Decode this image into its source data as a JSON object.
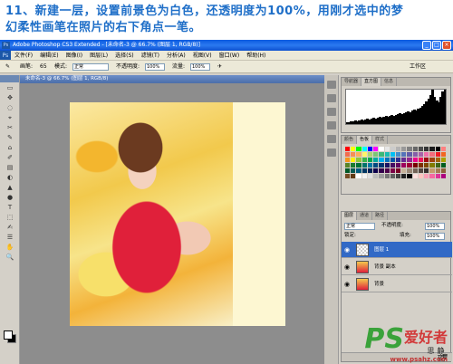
{
  "caption": {
    "line1": "11、新建一层，设置前景色为白色，还透明度为100%，用刚才选中的梦",
    "line2": "幻柔性画笔在照片的右下角点一笔。"
  },
  "window": {
    "title": "Adobe Photoshop CS3 Extended - [未命名-3 @ 66.7% (图层 1, RGB/8)]",
    "app_icon": "Ps",
    "buttons": [
      "_",
      "□",
      "×"
    ]
  },
  "menu": {
    "items": [
      "文件(F)",
      "编辑(E)",
      "图像(I)",
      "图层(L)",
      "选择(S)",
      "滤镜(T)",
      "分析(A)",
      "视图(V)",
      "窗口(W)",
      "帮助(H)"
    ]
  },
  "options": {
    "brush_label": "画笔:",
    "brush_size": "65",
    "mode_label": "模式:",
    "mode_value": "正常",
    "opacity_label": "不透明度:",
    "opacity_value": "100%",
    "flow_label": "流量:",
    "flow_value": "100%",
    "workspace_label": "工作区"
  },
  "document": {
    "tab_title": "未命名-3 @ 66.7% (图层 1, RGB/8)"
  },
  "tools": [
    "▭",
    "✥",
    "◌",
    "⌖",
    "✂",
    "✎",
    "⌂",
    "✐",
    "▤",
    "◐",
    "▲",
    "●",
    "T",
    "⬚",
    "✍",
    "☰",
    "✋",
    "🔍"
  ],
  "panels": {
    "navigator_tabs": [
      "导航器",
      "直方图",
      "信息"
    ],
    "swatch_tabs": [
      "颜色",
      "色板",
      "样式"
    ],
    "layer_tabs": [
      "图层",
      "通道",
      "路径"
    ],
    "blend_mode": "正常",
    "opacity_label": "不透明度:",
    "opacity_value": "100%",
    "lock_label": "锁定:",
    "fill_label": "填充:",
    "fill_value": "100%",
    "layers": [
      {
        "name": "图层 1",
        "selected": true
      },
      {
        "name": "背景 副本",
        "selected": false
      },
      {
        "name": "背景",
        "selected": false
      }
    ]
  },
  "swatch_colors": [
    "#ff0000",
    "#ffff00",
    "#00ff00",
    "#00ffff",
    "#0000ff",
    "#ff00ff",
    "#ffffff",
    "#e6e6e6",
    "#cccccc",
    "#b3b3b3",
    "#999999",
    "#808080",
    "#666666",
    "#4d4d4d",
    "#333333",
    "#1a1a1a",
    "#000000",
    "#ff8080",
    "#f26c4f",
    "#f68e56",
    "#fbaf5d",
    "#fff467",
    "#acd372",
    "#7cc576",
    "#3bb878",
    "#1abbb4",
    "#00bff3",
    "#438ccb",
    "#5574b9",
    "#605ca8",
    "#855fa8",
    "#a763a8",
    "#f06eaa",
    "#f26d7d",
    "#ed1c24",
    "#f26522",
    "#f7941d",
    "#fff200",
    "#8dc63f",
    "#39b54a",
    "#00a651",
    "#00a99d",
    "#00aeef",
    "#0072bc",
    "#0054a6",
    "#2e3192",
    "#662d91",
    "#92278f",
    "#ec008c",
    "#ed145b",
    "#9e0b0f",
    "#a0410d",
    "#a36209",
    "#aba000",
    "#598527",
    "#1a7b30",
    "#007236",
    "#00746b",
    "#0076a3",
    "#004a80",
    "#003471",
    "#1b1464",
    "#440e62",
    "#630460",
    "#9e005d",
    "#9e0039",
    "#790000",
    "#7b2e00",
    "#7d4900",
    "#827b00",
    "#406618",
    "#005e20",
    "#005826",
    "#005952",
    "#005b7f",
    "#003663",
    "#002157",
    "#0d004c",
    "#32004b",
    "#4b0049",
    "#7b0046",
    "#7a0026",
    "#c7b299",
    "#998675",
    "#736357",
    "#534741",
    "#362f2d",
    "#c69c6d",
    "#a67c52",
    "#8c6239",
    "#754c24",
    "#603913",
    "#ffffff",
    "#f2f2f2",
    "#e0e0e0",
    "#bdbdbd",
    "#9e9e9e",
    "#757575",
    "#616161",
    "#424242",
    "#212121",
    "#000000",
    "#fde0dd",
    "#fcc5c0",
    "#fa9fb5",
    "#f768a1",
    "#dd3497",
    "#ae017e"
  ],
  "histogram_bars": [
    2,
    2,
    3,
    3,
    4,
    3,
    4,
    5,
    4,
    5,
    6,
    5,
    6,
    7,
    6,
    7,
    8,
    7,
    8,
    9,
    8,
    9,
    10,
    9,
    10,
    11,
    12,
    11,
    12,
    13,
    14,
    13,
    15,
    16,
    15,
    17,
    18,
    20,
    22,
    25,
    28,
    32,
    38,
    30,
    26,
    24,
    30,
    36,
    40,
    38
  ],
  "watermark": {
    "ps": "PS",
    "cn": "爱好者",
    "url": "www.psahz.com",
    "calligraphy": "静夜思"
  }
}
